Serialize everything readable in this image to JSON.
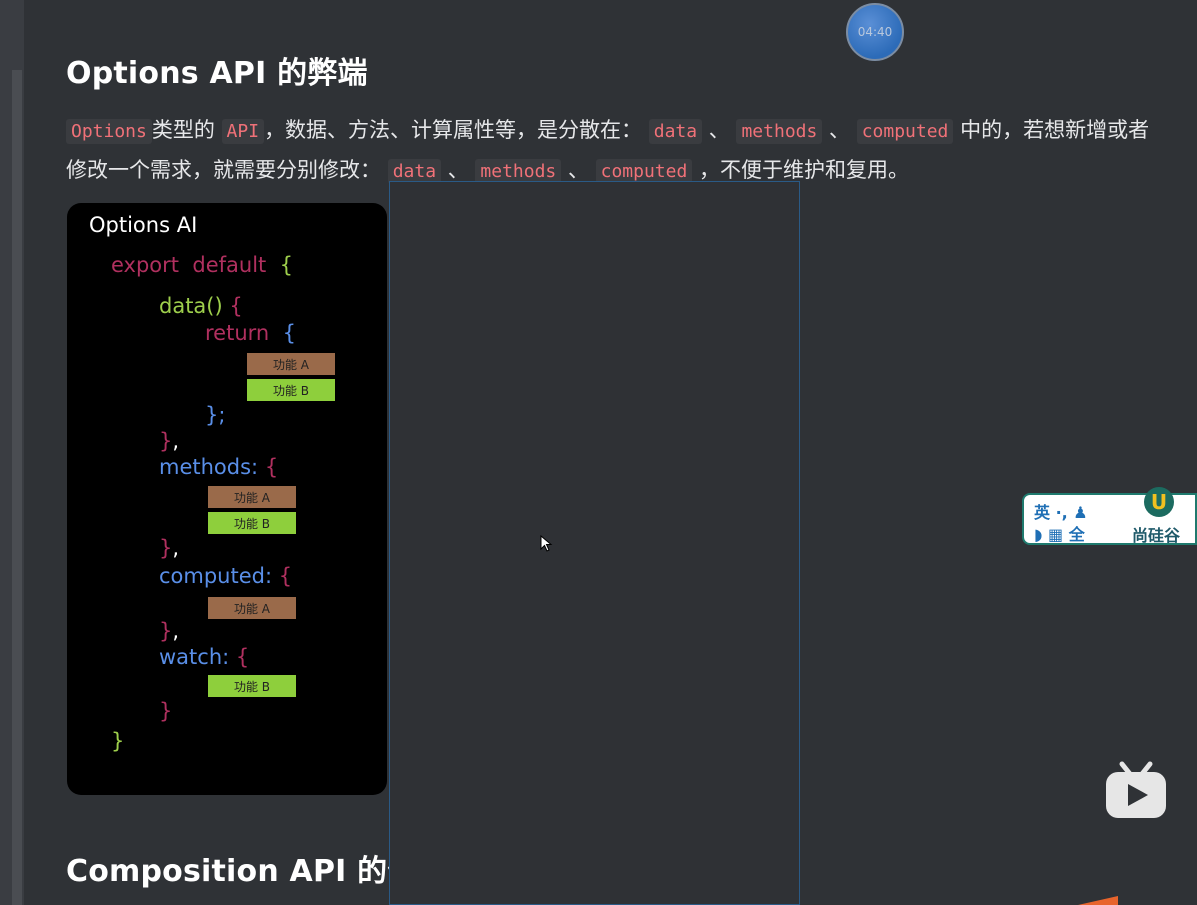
{
  "overlay": {
    "timer": "04:40"
  },
  "section1": {
    "title": "Options API 的弊端",
    "paragraph": [
      {
        "code": "Options"
      },
      {
        "text": "类型的 "
      },
      {
        "code": "API"
      },
      {
        "text": "，数据、方法、计算属性等，是分散在： "
      },
      {
        "code": "data"
      },
      {
        "text": " 、 "
      },
      {
        "code": "methods"
      },
      {
        "text": " 、 "
      },
      {
        "code": "computed"
      },
      {
        "text": " 中的，若想新增或者修改一个需求，就需要分别修改： "
      },
      {
        "code": "data"
      },
      {
        "text": " 、 "
      },
      {
        "code": "methods"
      },
      {
        "text": " 、 "
      },
      {
        "code": "computed"
      },
      {
        "text": " ，不便于维护和复用。"
      }
    ]
  },
  "diagram": {
    "title": "Options AI",
    "export_kw": "export",
    "default_kw": "default",
    "data_fn": "data()",
    "return_kw": "return",
    "methods_key": "methods:",
    "computed_key": "computed:",
    "watch_key": "watch:",
    "feature_a": "功能 A",
    "feature_b": "功能 B"
  },
  "section2": {
    "title": "Composition API 的优"
  },
  "ime": {
    "row1": "英 ·, ♟",
    "row2": "◗ ▦ 全",
    "brand": "尚硅谷",
    "badge": "U"
  },
  "colors": {
    "inline_code": "#f07178",
    "keyword": "#b0305f",
    "function": "#9ecf4c",
    "property": "#5a8fe8",
    "feature_a": "#9a6a4a",
    "feature_b": "#8ecf3c"
  }
}
